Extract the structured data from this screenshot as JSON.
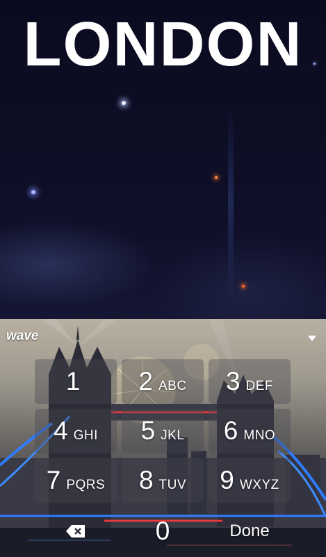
{
  "preview": {
    "title": "LONDON"
  },
  "keyboard": {
    "brand": "wave",
    "icons": {
      "collapse": "chevron-down-icon",
      "backspace": "backspace-icon"
    },
    "keys": [
      {
        "num": "1",
        "letters": ""
      },
      {
        "num": "2",
        "letters": "ABC"
      },
      {
        "num": "3",
        "letters": "DEF"
      },
      {
        "num": "4",
        "letters": "GHI"
      },
      {
        "num": "5",
        "letters": "JKL"
      },
      {
        "num": "6",
        "letters": "MNO"
      },
      {
        "num": "7",
        "letters": "PQRS"
      },
      {
        "num": "8",
        "letters": "TUV"
      },
      {
        "num": "9",
        "letters": "WXYZ"
      },
      {
        "num": "0",
        "letters": ""
      }
    ],
    "done_label": "Done"
  },
  "colors": {
    "accent_blue": "#2f7cff",
    "accent_red": "#e23a3a"
  }
}
